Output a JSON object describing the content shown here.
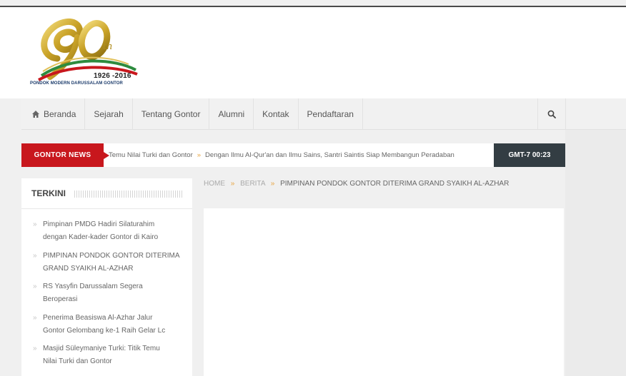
{
  "logo": {
    "anniversary": "90",
    "suffix": "th",
    "years": "1926 -2016",
    "name": "PONDOK MODERN DARUSSALAM GONTOR"
  },
  "nav": {
    "items": [
      {
        "label": "Beranda",
        "icon": "home-icon"
      },
      {
        "label": "Sejarah"
      },
      {
        "label": "Tentang Gontor"
      },
      {
        "label": "Alumni"
      },
      {
        "label": "Kontak"
      },
      {
        "label": "Pendaftaran"
      }
    ],
    "search_icon": "search-icon"
  },
  "ticker": {
    "label": "GONTOR NEWS",
    "items": [
      "Temu Nilai Turki dan Gontor",
      "Dengan Ilmu Al-Qur'an dan Ilmu Sains, Santri Saintis Siap Membangun Peradaban"
    ],
    "time": "GMT-7 00:23"
  },
  "sidebar": {
    "title": "TERKINI",
    "items": [
      {
        "line1": "Pimpinan PMDG Hadiri Silaturahim",
        "line2": "dengan Kader-kader Gontor di Kairo"
      },
      {
        "line1": "PIMPINAN PONDOK GONTOR DITERIMA",
        "line2": "GRAND SYAIKH AL-AZHAR"
      },
      {
        "line1": "RS Yasyfin Darussalam Segera",
        "line2": "Beroperasi"
      },
      {
        "line1": "Penerima Beasiswa Al-Azhar Jalur",
        "line2": "Gontor Gelombang ke-1 Raih Gelar Lc"
      },
      {
        "line1": "Masjid Süleymaniye Turki: Titik Temu",
        "line2": "Nilai Turki dan Gontor"
      }
    ]
  },
  "breadcrumb": {
    "home": "HOME",
    "section": "BERITA",
    "current": "PIMPINAN PONDOK GONTOR DITERIMA GRAND SYAIKH AL-AZHAR"
  },
  "colors": {
    "accent_red": "#c8171d",
    "ticker_time_bg": "#333d43",
    "separator_orange": "#e8a33c",
    "logo_gold": "#c9a227",
    "logo_green": "#2e8b3e"
  }
}
